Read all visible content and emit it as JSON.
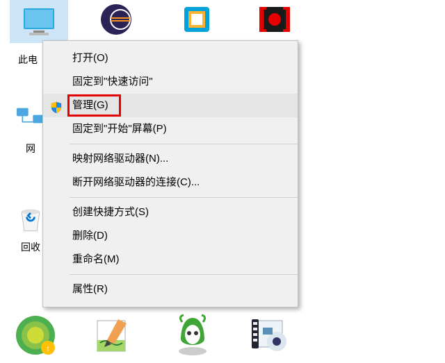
{
  "desktop_icons": {
    "this_pc_label": "此电",
    "network_label": "网",
    "recycle_label": "回收"
  },
  "context_menu": {
    "open": "打开(O)",
    "pin_quick_access": "固定到\"快速访问\"",
    "manage": "管理(G)",
    "pin_start": "固定到\"开始\"屏幕(P)",
    "map_network_drive": "映射网络驱动器(N)...",
    "disconnect_network_drive": "断开网络驱动器的连接(C)...",
    "create_shortcut": "创建快捷方式(S)",
    "delete": "删除(D)",
    "rename": "重命名(M)",
    "properties": "属性(R)"
  }
}
